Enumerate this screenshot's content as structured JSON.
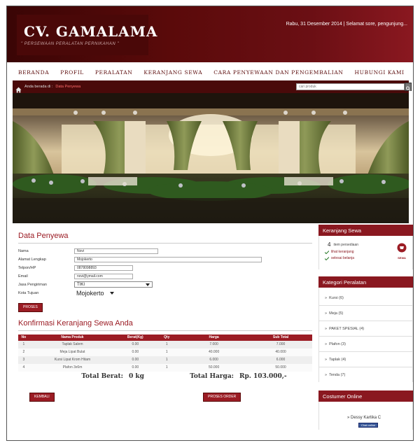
{
  "header": {
    "brand_title": "CV. GAMALAMA",
    "brand_subtitle": "\" PERSEWAAN PERALATAN PERNIKAHAN \"",
    "status": "Rabu, 31 Desember 2014 | Selamat sore, pengunjung..."
  },
  "nav": {
    "items": [
      "BERANDA",
      "PROFIL",
      "PERALATAN",
      "KERANJANG SEWA",
      "CARA PENYEWAAN DAN PENGEMBALIAN",
      "HUBUNGI KAMI"
    ]
  },
  "breadcrumb": {
    "prefix": "Anda berada di :",
    "current": "Data Penyewa"
  },
  "search": {
    "placeholder": "cari produk"
  },
  "form": {
    "title": "Data Penyewa",
    "fields": [
      {
        "label": "Nama",
        "value": "Novi"
      },
      {
        "label": "Alamat Lengkap",
        "value": "Mojokerto"
      },
      {
        "label": "Telpon/HP",
        "value": "0878098893"
      },
      {
        "label": "Email",
        "value": "novi@ymail.com"
      },
      {
        "label": "Jasa Pengiriman",
        "value": "TIKI"
      },
      {
        "label": "Kota Tujuan",
        "value": "Mojokerto"
      }
    ],
    "submit_label": "PROSES"
  },
  "cart": {
    "title": "Konfirmasi Keranjang Sewa Anda",
    "columns": [
      "No",
      "Nama Produk",
      "Berat(Kg)",
      "Qty",
      "Harga",
      "Sub Total"
    ],
    "rows": [
      [
        "1",
        "Taplak Salem",
        "0.00",
        "1",
        "7.000",
        "7.000"
      ],
      [
        "2",
        "Meja Lipat Bulat",
        "0.00",
        "1",
        "40.000",
        "40.000"
      ],
      [
        "3",
        "Kursi Lipat Krom Hitam",
        "0.00",
        "1",
        "6.000",
        "6.000"
      ],
      [
        "4",
        "Plafon 3x6m",
        "0.00",
        "1",
        "50.000",
        "50.000"
      ]
    ],
    "total_weight_label": "Total Berat:",
    "total_weight_value": "0 kg",
    "total_price_label": "Total Harga:",
    "total_price_value": "Rp. 103.000,-",
    "back_label": "KEMBALI",
    "order_label": "PROSES ORDER"
  },
  "sidebar": {
    "cart_title": "Keranjang Sewa",
    "cart_count": "4",
    "cart_count_suffix": "item persediaan",
    "cart_view": "lihat keranjang",
    "cart_done": "selesai belanja",
    "cart_badge": "SEWA",
    "category_title": "Kategori Peralatan",
    "categories": [
      "Kursi (6)",
      "Meja (5)",
      "PAKET SPESIAL (4)",
      "Plafon (3)",
      "Taplak (4)",
      "Tenda (7)"
    ],
    "online_title": "Costumer Online",
    "online_user": "Dessy Kartika C",
    "online_badge": "Chat online"
  },
  "colors": {
    "brand": "#6b0f14",
    "accent": "#9b1c24"
  }
}
